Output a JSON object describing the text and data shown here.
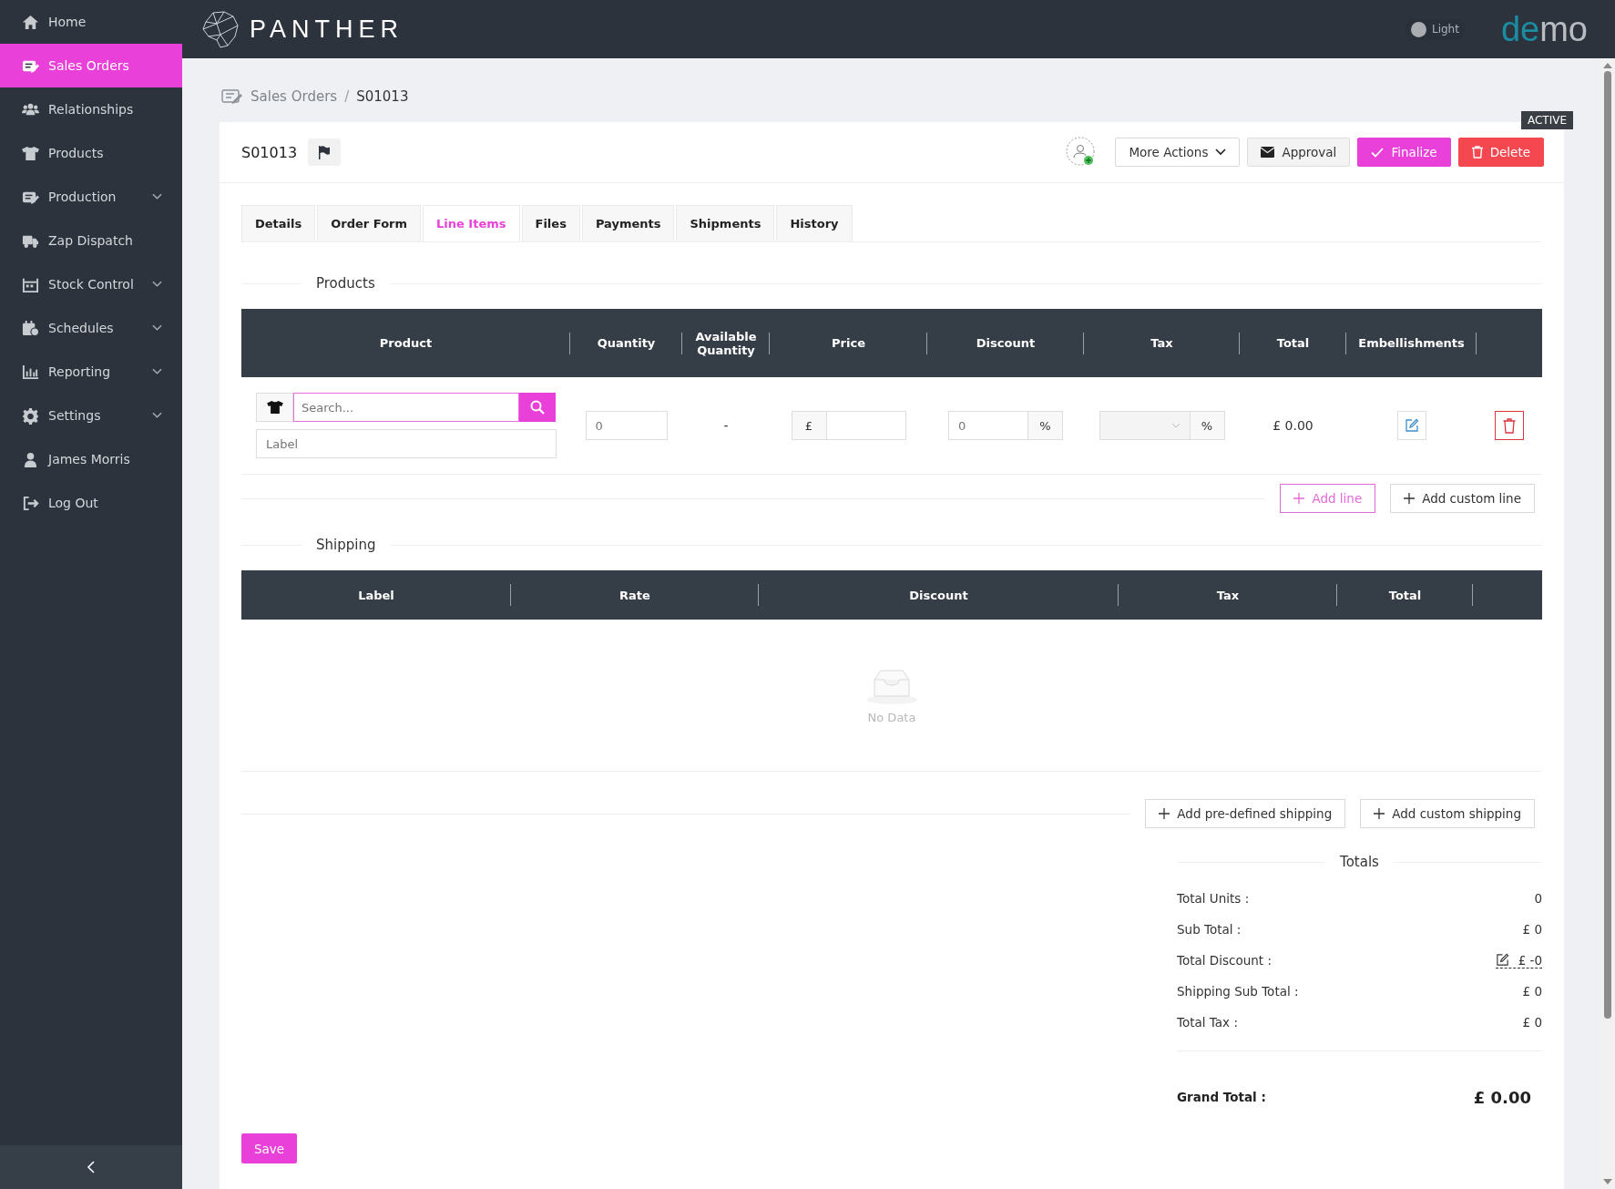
{
  "sidebar": {
    "items": [
      {
        "label": "Home",
        "selected": false,
        "expandable": false
      },
      {
        "label": "Sales Orders",
        "selected": true,
        "expandable": false
      },
      {
        "label": "Relationships",
        "selected": false,
        "expandable": false
      },
      {
        "label": "Products",
        "selected": false,
        "expandable": false
      },
      {
        "label": "Production",
        "selected": false,
        "expandable": true
      },
      {
        "label": "Zap Dispatch",
        "selected": false,
        "expandable": false
      },
      {
        "label": "Stock Control",
        "selected": false,
        "expandable": true
      },
      {
        "label": "Schedules",
        "selected": false,
        "expandable": true
      },
      {
        "label": "Reporting",
        "selected": false,
        "expandable": true
      },
      {
        "label": "Settings",
        "selected": false,
        "expandable": true
      },
      {
        "label": "James Morris",
        "selected": false,
        "expandable": false
      },
      {
        "label": "Log Out",
        "selected": false,
        "expandable": false
      }
    ]
  },
  "header": {
    "logo_text": "PANTHER",
    "theme_toggle": {
      "label": "Light",
      "on": false
    },
    "brand": [
      "de",
      "mo"
    ]
  },
  "breadcrumb": [
    "Sales Orders",
    "/",
    "S01013"
  ],
  "order": {
    "number": "S01013",
    "status": "ACTIVE",
    "actions": [
      {
        "label": "More Actions",
        "kind": "dropdown"
      },
      {
        "label": "Approval",
        "kind": "approval"
      },
      {
        "label": "Finalize",
        "kind": "finalize"
      },
      {
        "label": "Delete",
        "kind": "delete"
      }
    ]
  },
  "tabs": [
    {
      "label": "Details",
      "selected": false
    },
    {
      "label": "Order Form",
      "selected": false
    },
    {
      "label": "Line Items",
      "selected": true
    },
    {
      "label": "Files",
      "selected": false
    },
    {
      "label": "Payments",
      "selected": false
    },
    {
      "label": "Shipments",
      "selected": false
    },
    {
      "label": "History",
      "selected": false
    }
  ],
  "products": {
    "title": "Products",
    "columns": [
      "Product",
      "Quantity",
      "Available Quantity",
      "Price",
      "Discount",
      "Tax",
      "Total",
      "Embellishments"
    ],
    "row": {
      "search_placeholder": "Search...",
      "label_placeholder": "Label",
      "quantity_placeholder": "0",
      "available": "-",
      "currency": "£",
      "discount_placeholder": "0",
      "discount_unit": "%",
      "tax_unit": "%",
      "total": "£ 0.00"
    },
    "buttons": [
      {
        "label": "Add line",
        "kind": "primary"
      },
      {
        "label": "Add custom line",
        "kind": "default"
      }
    ]
  },
  "shipping": {
    "title": "Shipping",
    "columns": [
      "Label",
      "Rate",
      "Discount",
      "Tax",
      "Total"
    ],
    "empty_text": "No Data",
    "buttons": [
      "Add pre-defined shipping",
      "Add custom shipping"
    ]
  },
  "totals": {
    "title": "Totals",
    "rows": [
      {
        "label": "Total Units :",
        "value": "0",
        "editable": false
      },
      {
        "label": "Sub Total :",
        "value": "£ 0",
        "editable": false
      },
      {
        "label": "Total Discount :",
        "value": "£ -0",
        "editable": true
      },
      {
        "label": "Shipping Sub Total :",
        "value": "£ 0",
        "editable": false
      },
      {
        "label": "Total Tax :",
        "value": "£ 0",
        "editable": false
      }
    ],
    "grand_total": {
      "label": "Grand Total :",
      "value": "£ 0.00"
    }
  },
  "save_button": "Save"
}
